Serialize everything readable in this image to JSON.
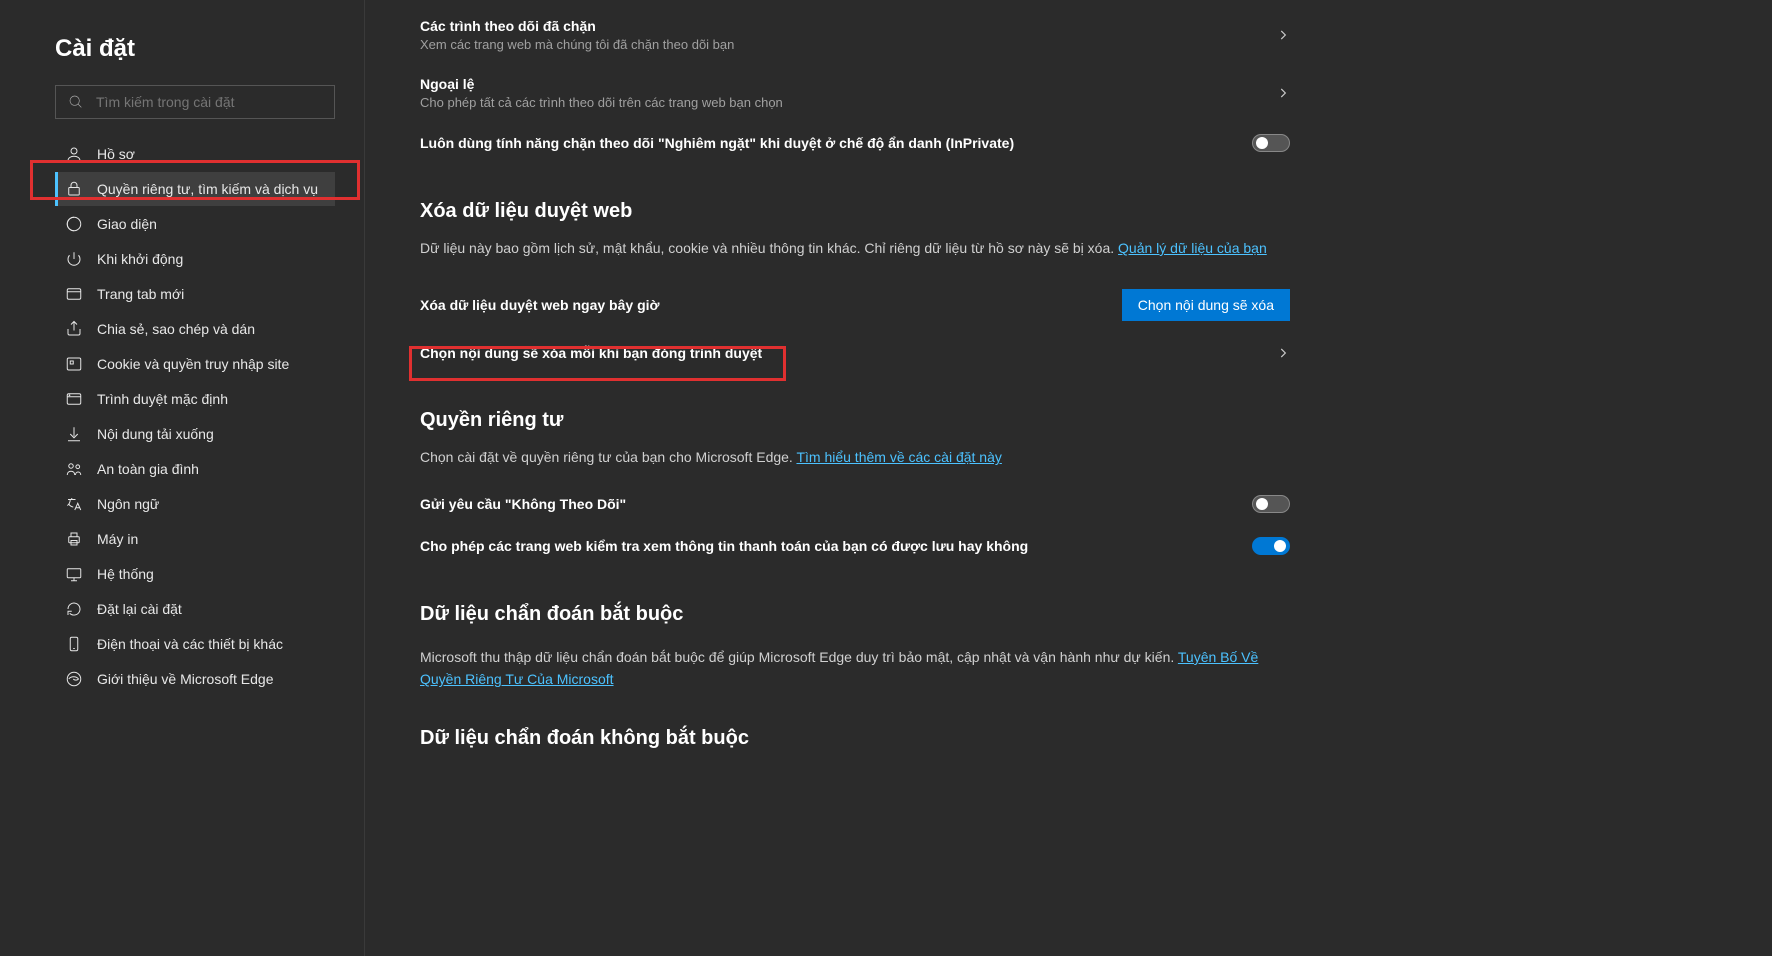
{
  "sidebar": {
    "title": "Cài đặt",
    "search_placeholder": "Tìm kiếm trong cài đặt",
    "items": [
      {
        "label": "Hồ sơ"
      },
      {
        "label": "Quyền riêng tư, tìm kiếm và dịch vụ"
      },
      {
        "label": "Giao diện"
      },
      {
        "label": "Khi khởi động"
      },
      {
        "label": "Trang tab mới"
      },
      {
        "label": "Chia sẻ, sao chép và dán"
      },
      {
        "label": "Cookie và quyền truy nhập site"
      },
      {
        "label": "Trình duyệt mặc định"
      },
      {
        "label": "Nội dung tải xuống"
      },
      {
        "label": "An toàn gia đình"
      },
      {
        "label": "Ngôn ngữ"
      },
      {
        "label": "Máy in"
      },
      {
        "label": "Hệ thống"
      },
      {
        "label": "Đặt lại cài đặt"
      },
      {
        "label": "Điện thoại và các thiết bị khác"
      },
      {
        "label": "Giới thiệu về Microsoft Edge"
      }
    ]
  },
  "main": {
    "blocked_trackers": {
      "title": "Các trình theo dõi đã chặn",
      "sub": "Xem các trang web mà chúng tôi đã chặn theo dõi bạn"
    },
    "exceptions": {
      "title": "Ngoại lệ",
      "sub": "Cho phép tất cả các trình theo dõi trên các trang web bạn chọn"
    },
    "strict_inprivate": {
      "title": "Luôn dùng tính năng chặn theo dõi \"Nghiêm ngặt\" khi duyệt ở chế độ ẩn danh (InPrivate)"
    },
    "clear_data": {
      "heading": "Xóa dữ liệu duyệt web",
      "desc_a": "Dữ liệu này bao gồm lịch sử, mật khẩu, cookie và nhiều thông tin khác. Chỉ riêng dữ liệu từ hồ sơ này sẽ bị xóa. ",
      "link": "Quản lý dữ liệu của bạn",
      "now_label": "Xóa dữ liệu duyệt web ngay bây giờ",
      "now_button": "Chọn nội dung sẽ xóa",
      "on_close": "Chọn nội dung sẽ xóa mỗi khi bạn đóng trình duyệt"
    },
    "privacy": {
      "heading": "Quyền riêng tư",
      "desc_a": "Chọn cài đặt về quyền riêng tư của bạn cho Microsoft Edge. ",
      "link": "Tìm hiểu thêm về các cài đặt này",
      "dnt": "Gửi yêu cầu \"Không Theo Dõi\"",
      "payment": "Cho phép các trang web kiểm tra xem thông tin thanh toán của bạn có được lưu hay không"
    },
    "diag_req": {
      "heading": "Dữ liệu chẩn đoán bắt buộc",
      "desc_a": "Microsoft thu thập dữ liệu chẩn đoán bắt buộc để giúp Microsoft Edge duy trì bảo mật, cập nhật và vận hành như dự kiến. ",
      "link": "Tuyên Bố Về Quyền Riêng Tư Của Microsoft"
    },
    "diag_opt": {
      "heading": "Dữ liệu chẩn đoán không bắt buộc"
    }
  }
}
